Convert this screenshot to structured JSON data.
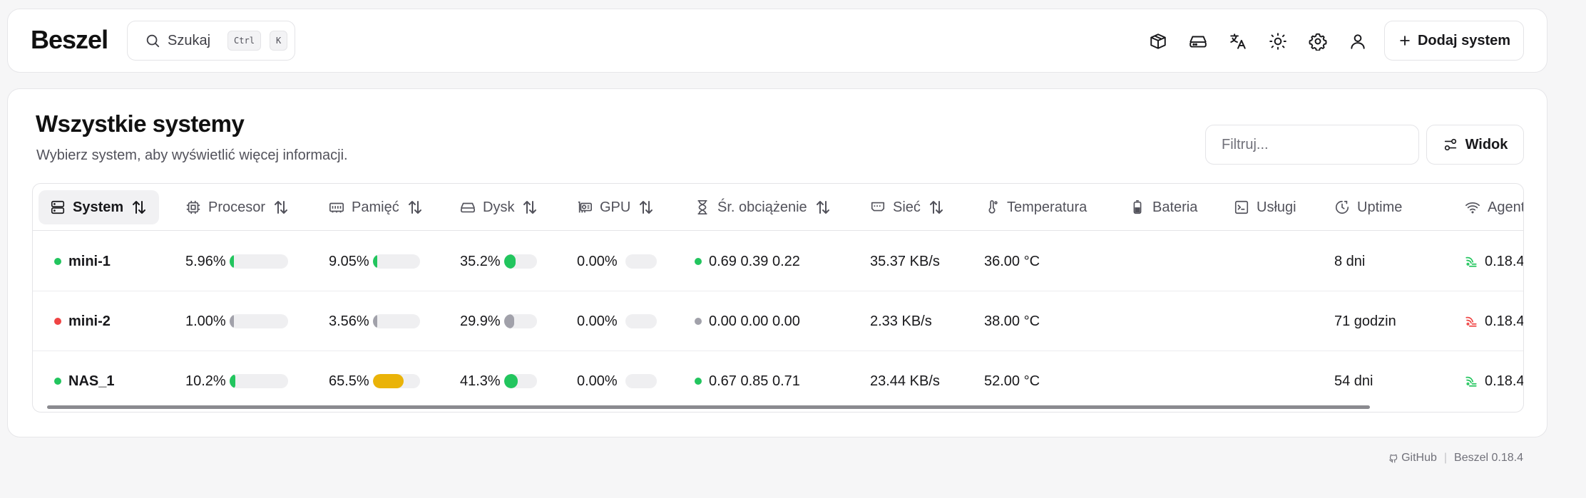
{
  "app": {
    "logo": "Beszel"
  },
  "search": {
    "label": "Szukaj",
    "kbd_ctrl": "Ctrl",
    "kbd_k": "K"
  },
  "header": {
    "icons": [
      "box-icon",
      "hard-drive-icon",
      "language-icon",
      "sun-icon",
      "gear-icon",
      "user-icon"
    ],
    "add_system_label": "Dodaj system"
  },
  "main": {
    "title": "Wszystkie systemy",
    "subtitle": "Wybierz system, aby wyświetlić więcej informacji.",
    "filter_placeholder": "Filtruj...",
    "view_label": "Widok"
  },
  "table": {
    "columns": {
      "system": "System",
      "cpu": "Procesor",
      "memory": "Pamięć",
      "disk": "Dysk",
      "gpu": "GPU",
      "load": "Śr. obciążenie",
      "net": "Sieć",
      "temp": "Temperatura",
      "battery": "Bateria",
      "services": "Usługi",
      "uptime": "Uptime",
      "agent": "Agent"
    },
    "rows": [
      {
        "name": "mini-1",
        "status_color": "#22c55e",
        "cpu": "5.96%",
        "cpu_pct": 5.96,
        "cpu_color": "#22c55e",
        "mem": "9.05%",
        "mem_pct": 9.05,
        "mem_color": "#22c55e",
        "disk": "35.2%",
        "disk_pct": 35.2,
        "disk_color": "#22c55e",
        "gpu": "0.00%",
        "gpu_pct": 0,
        "load_color": "#22c55e",
        "load": "0.69 0.39 0.22",
        "net": "35.37 KB/s",
        "temp": "36.00 °C",
        "uptime": "8 dni",
        "agent_color": "#22c55e",
        "agent": "0.18.4"
      },
      {
        "name": "mini-2",
        "status_color": "#ef4444",
        "cpu": "1.00%",
        "cpu_pct": 1.0,
        "cpu_color": "#a1a1aa",
        "mem": "3.56%",
        "mem_pct": 3.56,
        "mem_color": "#a1a1aa",
        "disk": "29.9%",
        "disk_pct": 29.9,
        "disk_color": "#a1a1aa",
        "gpu": "0.00%",
        "gpu_pct": 0,
        "load_color": "#a1a1aa",
        "load": "0.00 0.00 0.00",
        "net": "2.33 KB/s",
        "temp": "38.00 °C",
        "uptime": "71 godzin",
        "agent_color": "#ef4444",
        "agent": "0.18.4"
      },
      {
        "name": "NAS_1",
        "status_color": "#22c55e",
        "cpu": "10.2%",
        "cpu_pct": 10.2,
        "cpu_color": "#22c55e",
        "mem": "65.5%",
        "mem_pct": 65.5,
        "mem_color": "#eab308",
        "disk": "41.3%",
        "disk_pct": 41.3,
        "disk_color": "#22c55e",
        "gpu": "0.00%",
        "gpu_pct": 0,
        "load_color": "#22c55e",
        "load": "0.67 0.85 0.71",
        "net": "23.44 KB/s",
        "temp": "52.00 °C",
        "uptime": "54 dni",
        "agent_color": "#22c55e",
        "agent": "0.18.4"
      }
    ]
  },
  "footer": {
    "github": "GitHub",
    "version": "Beszel 0.18.4"
  }
}
